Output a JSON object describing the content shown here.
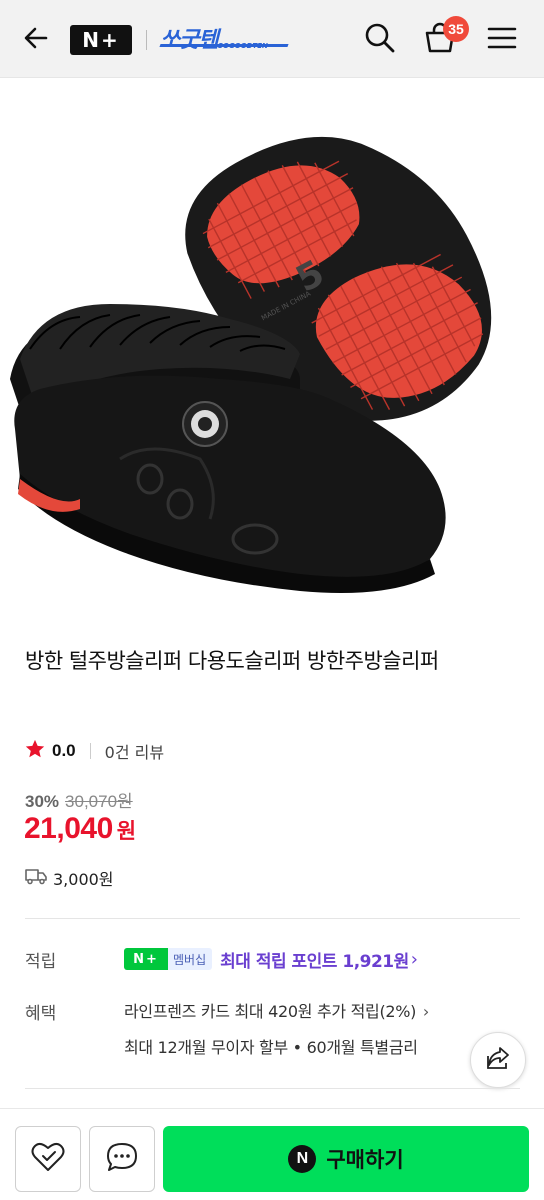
{
  "header": {
    "logo_text": "N+",
    "brand_name": "쏘굿텐",
    "brand_sub": "SOGOODTEN",
    "cart_count": "35"
  },
  "product": {
    "title": "방한 털주방슬리퍼 다용도슬리퍼 방한주방슬리퍼",
    "rating": "0.0",
    "review_count": "0건 리뷰",
    "discount_percent": "30%",
    "original_price": "30,070원",
    "price": "21,040",
    "price_unit": "원",
    "shipping_fee": "3,000원",
    "sole_text": "MADE IN CHINA"
  },
  "points": {
    "label": "적립",
    "badge_logo": "N+",
    "badge_text": "멤버십",
    "text": "최대 적립 포인트 1,921원"
  },
  "benefits": {
    "label": "혜택",
    "line1": "라인프렌즈 카드 최대 420원 추가 적립(2%)",
    "line2": "최대 12개월 무이자 할부 • 60개월 특별금리"
  },
  "bottom_bar": {
    "buy_icon": "N",
    "buy_label": "구매하기"
  },
  "colors": {
    "header_bg": "#f2f2f2",
    "price_red": "#e8132c",
    "buy_green": "#00de5a",
    "point_purple": "#6a3fd0",
    "brand_blue": "#2a63d6",
    "badge_red": "#f04a3b"
  },
  "icons": [
    "back-arrow-icon",
    "search-icon",
    "cart-icon",
    "menu-icon",
    "star-icon",
    "truck-icon",
    "share-icon",
    "heart-check-icon",
    "chat-icon"
  ]
}
